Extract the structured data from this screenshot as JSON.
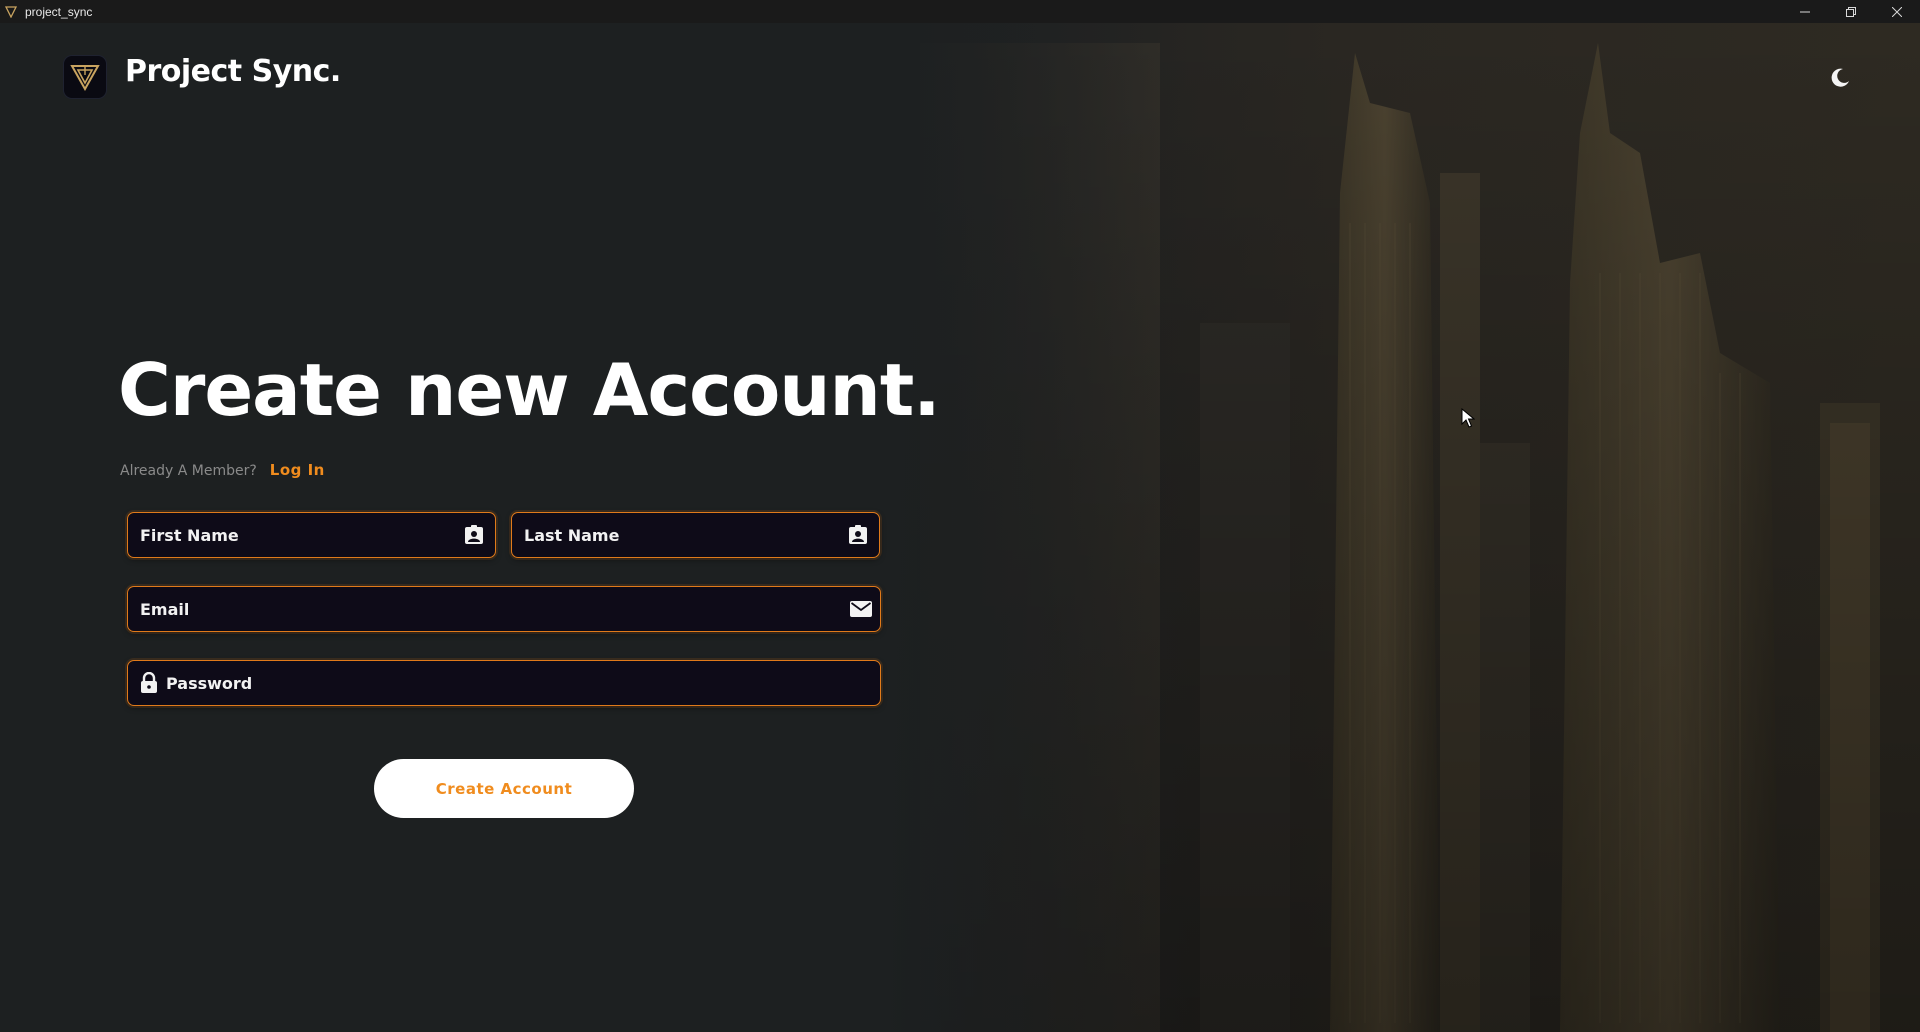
{
  "window": {
    "title": "project_sync",
    "minimize_icon": "minimize-icon",
    "restore_icon": "restore-icon",
    "close_icon": "close-icon"
  },
  "header": {
    "app_name": "Project Sync.",
    "logo_icon": "triangle-logo-icon",
    "theme_toggle_icon": "moon-icon"
  },
  "form": {
    "heading": "Create new Account.",
    "member_prompt": "Already A Member?",
    "login_link": "Log In",
    "first_name": {
      "value": "",
      "placeholder": "First Name",
      "icon": "contact-card-icon"
    },
    "last_name": {
      "value": "",
      "placeholder": "Last Name",
      "icon": "contact-card-icon"
    },
    "email": {
      "value": "",
      "placeholder": "Email",
      "icon": "envelope-icon"
    },
    "password": {
      "value": "",
      "placeholder": "Password",
      "icon": "lock-icon"
    },
    "submit_label": "Create Account"
  },
  "colors": {
    "accent": "#f08c1e",
    "background": "#1d2021",
    "field_bg": "#0e0b18",
    "button_bg": "#ffffff"
  }
}
